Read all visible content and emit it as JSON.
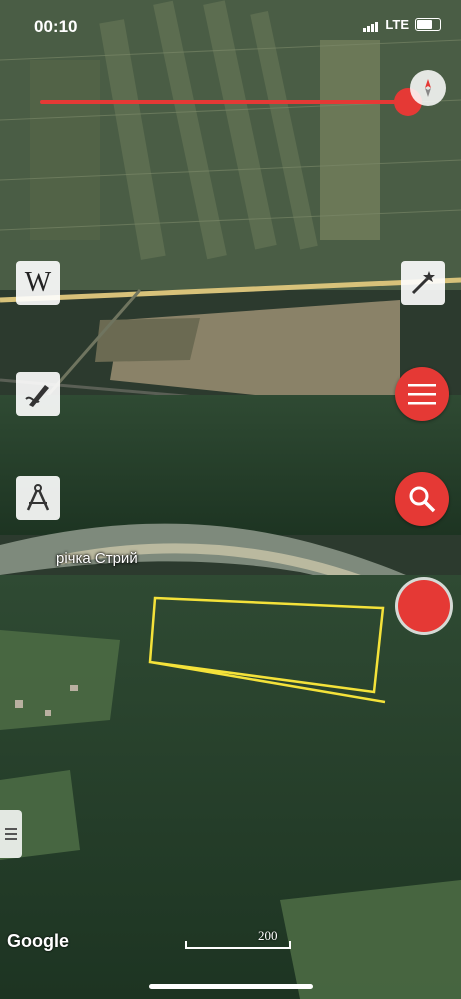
{
  "status_bar": {
    "time": "00:10",
    "network": "LTE"
  },
  "map": {
    "river_label": "річка Стрий",
    "attribution": "Google",
    "scale_label": "200",
    "highlight_color": "#f4e23a"
  },
  "controls": {
    "slider_value": 1.0,
    "wikipedia_label": "W",
    "icons": {
      "compass": "compass-icon",
      "wikipedia": "wikipedia-icon",
      "magic_wand": "magic-wand-icon",
      "draw": "draw-icon",
      "menu": "menu-icon",
      "measure": "compass-tool-icon",
      "search": "search-icon",
      "record": "record-icon",
      "side_panel": "side-panel-icon"
    },
    "accent": "#e53935"
  }
}
